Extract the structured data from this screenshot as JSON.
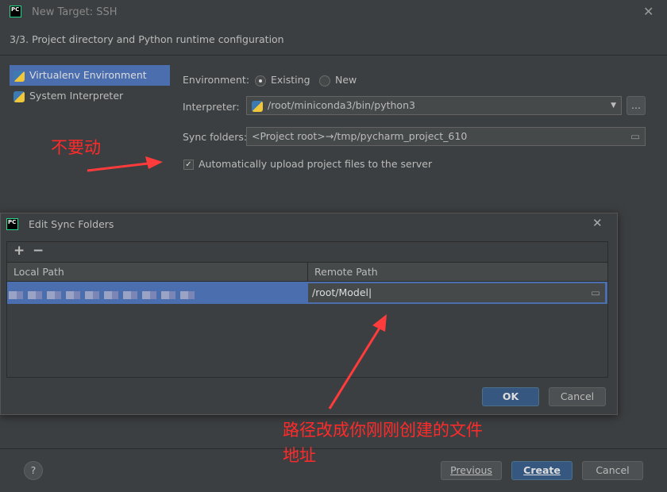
{
  "window": {
    "title": "New Target: SSH",
    "logo": "PC",
    "step": "3/3. Project directory and Python runtime configuration"
  },
  "sidebar": {
    "items": [
      {
        "label": "Virtualenv Environment",
        "selected": true
      },
      {
        "label": "System Interpreter",
        "selected": false
      }
    ]
  },
  "form": {
    "environment_label": "Environment:",
    "existing_label": "Existing",
    "new_label": "New",
    "interpreter_label": "Interpreter:",
    "interpreter_value": "/root/miniconda3/bin/python3",
    "more_label": "...",
    "sync_label": "Sync folders:",
    "sync_value": "<Project root>→/tmp/pycharm_project_610",
    "auto_upload_label": "Automatically upload project files to the server",
    "auto_upload_checked": true
  },
  "footer": {
    "help": "?",
    "previous": "Previous",
    "create": "Create",
    "cancel": "Cancel"
  },
  "sync_dialog": {
    "title": "Edit Sync Folders",
    "logo": "PC",
    "add": "+",
    "remove": "−",
    "col_local": "Local Path",
    "col_remote": "Remote Path",
    "remote_value": "/root/Model",
    "ok": "OK",
    "cancel": "Cancel"
  },
  "annotations": {
    "dont_touch": "不要动",
    "change_path": "路径改成你刚刚创建的文件",
    "change_path_2": "地址"
  },
  "colors": {
    "accent": "#4b6eaf",
    "annotation": "#ff2a2a"
  }
}
